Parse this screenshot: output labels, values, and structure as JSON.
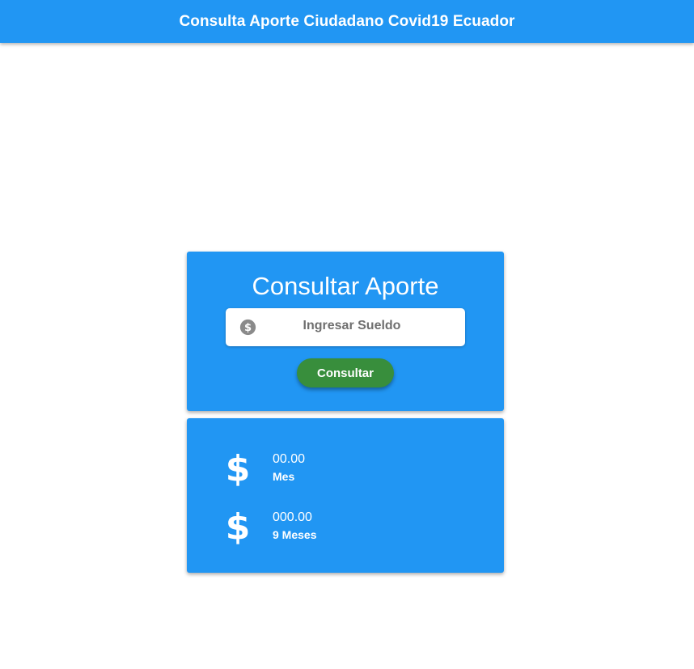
{
  "app_bar": {
    "title": "Consulta Aporte Ciudadano Covid19 Ecuador"
  },
  "form_card": {
    "title": "Consultar Aporte",
    "salary_field": {
      "icon": "monetization-icon",
      "placeholder": "Ingresar Sueldo",
      "value": ""
    },
    "consult_button_label": "Consultar"
  },
  "results_card": {
    "items": [
      {
        "icon": "dollar-icon",
        "amount": "00.00",
        "label": "Mes"
      },
      {
        "icon": "dollar-icon",
        "amount": "000.00",
        "label": "9 Meses"
      }
    ]
  },
  "colors": {
    "primary": "#2196f3",
    "button": "#388e3c",
    "text_on_primary": "#ffffff",
    "placeholder": "#6f6f6f"
  }
}
